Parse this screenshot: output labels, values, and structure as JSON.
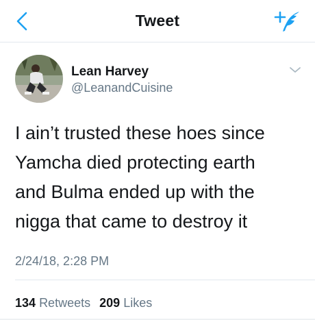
{
  "nav": {
    "title": "Tweet",
    "back_icon": "chevron-left-icon",
    "compose_icon": "compose-tweet-icon",
    "accent_color": "#1da1f2"
  },
  "author": {
    "display_name": "Lean Harvey",
    "handle": "@LeanandCuisine",
    "menu_icon": "chevron-down-icon"
  },
  "tweet": {
    "lines": [
      "I ain’t trusted these hoes since",
      "Yamcha died protecting earth",
      "and Bulma ended up with the",
      "nigga that came to destroy it"
    ],
    "timestamp": "2/24/18, 2:28 PM"
  },
  "stats": {
    "retweets_count": "134",
    "retweets_label": "Retweets",
    "likes_count": "209",
    "likes_label": "Likes"
  }
}
